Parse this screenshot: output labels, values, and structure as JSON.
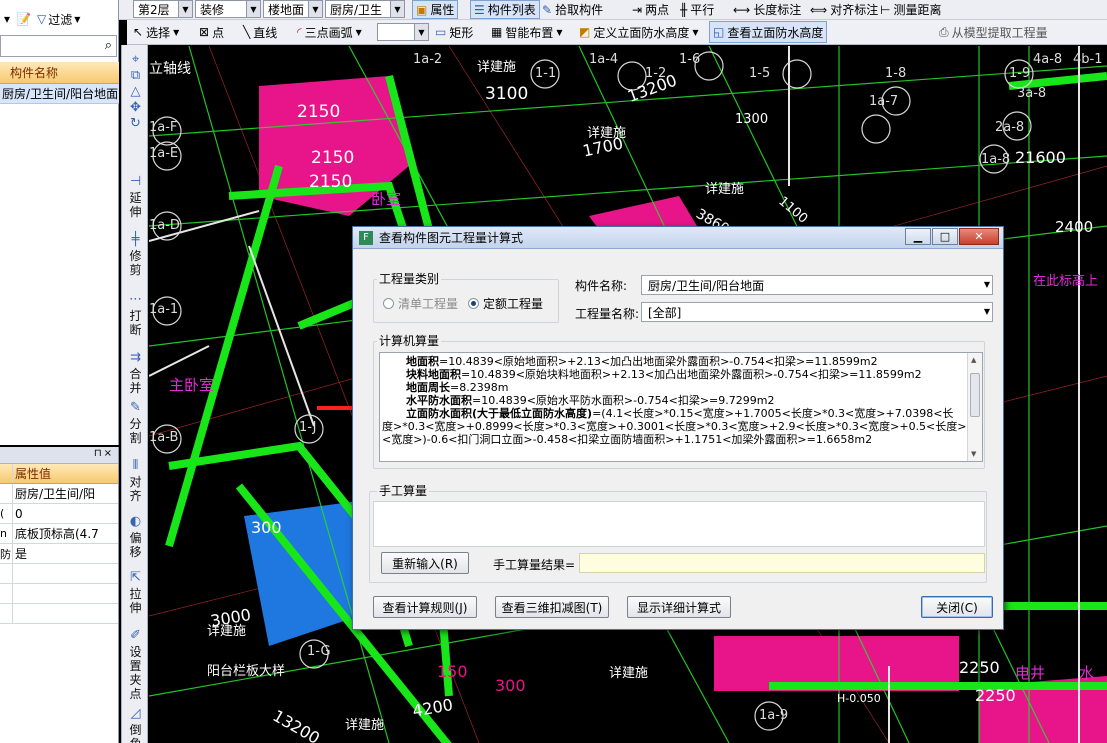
{
  "toolbar_top": {
    "floor": "第2层",
    "category": "装修",
    "element_type": "楼地面",
    "element_name": "厨房/卫生",
    "property_btn": "属性",
    "component_list_btn": "构件列表",
    "pick_component_btn": "拾取构件",
    "grid_btn": "两点",
    "parallel_btn": "平行",
    "dim_btn": "长度标注",
    "align_dim_btn": "对齐标注",
    "measure_btn": "测量距离",
    "filter_label": "过滤"
  },
  "toolbar_draw": {
    "select": "选择",
    "point": "点",
    "line": "直线",
    "arc": "三点画弧",
    "rect": "矩形",
    "smart_layout": "智能布置",
    "define_wp_height": "定义立面防水高度",
    "view_wp_height": "查看立面防水高度",
    "extract_btn": "从模型提取工程量"
  },
  "component_panel": {
    "header": "构件名称",
    "row": "厨房/卫生间/阳台地面"
  },
  "property_panel": {
    "header_value": "属性值",
    "rows": [
      {
        "k": "",
        "v": "厨房/卫生间/阳"
      },
      {
        "k": "(",
        "v": "0"
      },
      {
        "k": "n",
        "v": "底板顶标高(4.7"
      },
      {
        "k": "防",
        "v": "是"
      },
      {
        "k": "",
        "v": ""
      },
      {
        "k": "",
        "v": ""
      },
      {
        "k": "",
        "v": ""
      }
    ]
  },
  "vertical_tools": [
    "延伸",
    "修剪",
    "打断",
    "合并",
    "分割",
    "对齐",
    "偏移",
    "拉伸",
    "设置夹点",
    "倒角"
  ],
  "canvas_labels": {
    "bedroom": "卧室",
    "master_bedroom": "主卧室",
    "detail_construction": "详建施",
    "balcony_rail": "阳台栏板大样",
    "axis_label": "立轴线",
    "install_note": "在此标高上",
    "elec_well": "电井",
    "water": "水",
    "h_note": "H-0.050",
    "dims": [
      "2150",
      "2150",
      "2150",
      "3100",
      "3860",
      "1700",
      "1300",
      "1100",
      "2400",
      "21600",
      "13200",
      "13200",
      "4200",
      "3000",
      "300",
      "150",
      "300",
      "2250",
      "2250"
    ],
    "axes": [
      "1a-F",
      "1a-E",
      "1a-D",
      "1a-1",
      "1a-B",
      "1-J",
      "1-G",
      "1-6",
      "1-5",
      "1-8",
      "1-9",
      "1-2",
      "1-1",
      "4a-8",
      "4b-1",
      "3a-8",
      "2a-8",
      "1a-8",
      "1a-7",
      "1a-2",
      "1a-4",
      "1a-9"
    ]
  },
  "dialog": {
    "title": "查看构件图元工程量计算式",
    "qty_type_label": "工程量类别",
    "opt_list": "清单工程量",
    "opt_quota": "定额工程量",
    "component_label": "构件名称:",
    "component_value": "厨房/卫生间/阳台地面",
    "qty_name_label": "工程量名称:",
    "qty_name_value": "[全部]",
    "calc_label": "计算机算量",
    "calc_lines": [
      {
        "name": "地面积",
        "formula": "=10.4839<原始地面积>+2.13<加凸出地面梁外露面积>-0.754<扣梁>=11.8599m2"
      },
      {
        "name": "块料地面积",
        "formula": "=10.4839<原始块料地面积>+2.13<加凸出地面梁外露面积>-0.754<扣梁>=11.8599m2"
      },
      {
        "name": "地面周长",
        "formula": "=8.2398m"
      },
      {
        "name": "水平防水面积",
        "formula": "=10.4839<原始水平防水面积>-0.754<扣梁>=9.7299m2"
      },
      {
        "name": "立面防水面积(大于最低立面防水高度)",
        "formula": "=(4.1<长度>*0.15<宽度>+1.7005<长度>*0.3<宽度>+7.0398<长"
      },
      {
        "name": "",
        "formula": "度>*0.3<宽度>+0.8999<长度>*0.3<宽度>+0.3001<长度>*0.3<宽度>+2.9<长度>*0.3<宽度>+0.5<长度>*0.15"
      },
      {
        "name": "",
        "formula": "<宽度>)-0.6<扣门洞口立面>-0.458<扣梁立面防墙面积>+1.1751<加梁外露面积>=1.6658m2"
      }
    ],
    "manual_label": "手工算量",
    "reinput_btn": "重新输入(R)",
    "manual_result_label": "手工算量结果=",
    "rule_btn": "查看计算规则(J)",
    "deduct3d_btn": "查看三维扣减图(T)",
    "detail_btn": "显示详细计算式",
    "close_btn": "关闭(C)"
  }
}
